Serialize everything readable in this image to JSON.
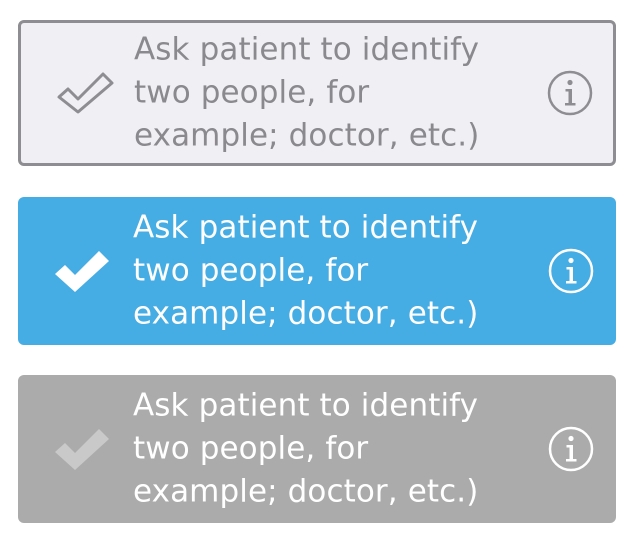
{
  "items": [
    {
      "state": "unchecked",
      "lines": [
        "Ask patient to identify",
        "two people, for",
        "example; doctor, etc.)"
      ],
      "check_icon": "checkmark-outline-icon",
      "info_icon": "info-icon"
    },
    {
      "state": "checked",
      "lines": [
        "Ask patient to identify",
        "two people, for",
        "example; doctor, etc.)"
      ],
      "check_icon": "checkmark-icon",
      "info_icon": "info-icon"
    },
    {
      "state": "disabled",
      "lines": [
        "Ask patient to identify",
        "two people, for",
        "example; doctor, etc.)"
      ],
      "check_icon": "checkmark-icon",
      "info_icon": "info-icon"
    }
  ],
  "colors": {
    "unchecked_bg": "#f0eff3",
    "unchecked_border": "#8e8e92",
    "unchecked_text": "#8a8a8e",
    "checked_bg": "#45ade4",
    "disabled_bg": "#ababab",
    "disabled_check": "#c9c9c9"
  }
}
